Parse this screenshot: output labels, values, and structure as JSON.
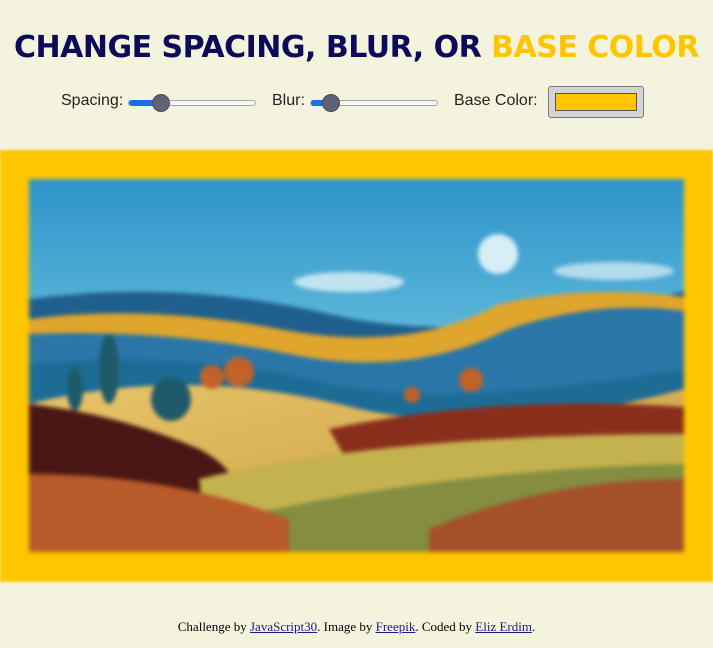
{
  "title": {
    "main": "CHANGE SPACING, BLUR, OR ",
    "highlight": "BASE COLOR"
  },
  "controls": {
    "spacing": {
      "label": "Spacing:",
      "value_fraction": 0.25
    },
    "blur": {
      "label": "Blur:",
      "value_fraction": 0.16
    },
    "base_color": {
      "label": "Base Color:",
      "value": "#ffc600"
    }
  },
  "colors": {
    "accent": "#ffc600",
    "title": "#0b0b5a",
    "background": "#f4f4de"
  },
  "footer": {
    "prefix": "Challenge by ",
    "link1": "JavaScript30",
    "mid1": ". Image by ",
    "link2": "Freepik",
    "mid2": ". Coded by ",
    "link3": "Eliz Erdim",
    "suffix": "."
  }
}
